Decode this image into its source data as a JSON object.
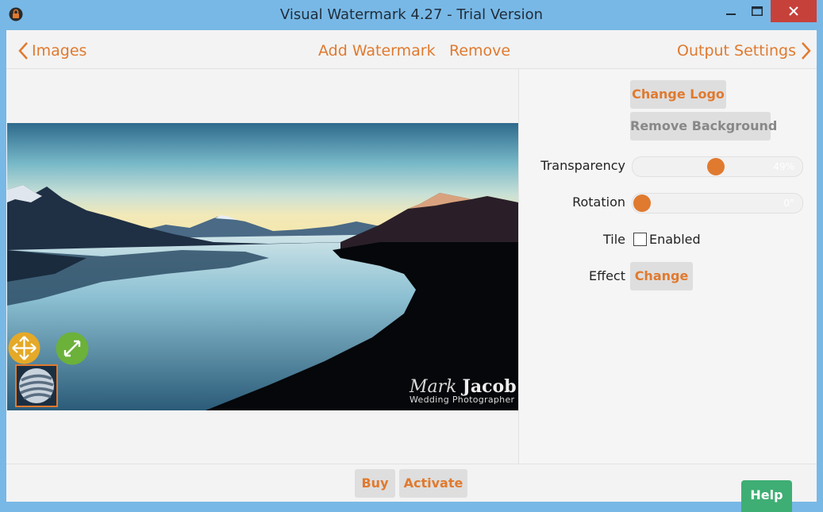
{
  "window": {
    "title": "Visual Watermark 4.27 - Trial Version",
    "icons": [
      "app-lock-icon",
      "minimize-icon",
      "maximize-icon",
      "close-icon"
    ],
    "close_color": "#c7413b"
  },
  "nav": {
    "back_label": "Images",
    "add_label": "Add Watermark",
    "remove_label": "Remove",
    "output_label": "Output Settings",
    "accent": "#e07a2f"
  },
  "watermark": {
    "first_name": "Mark",
    "last_name": "Jacob",
    "subtitle": "Wedding Photographer"
  },
  "panel": {
    "change_logo": "Change Logo",
    "remove_background": "Remove Background",
    "transparency_label": "Transparency",
    "transparency_value": "49%",
    "transparency_level": 0.49,
    "rotation_label": "Rotation",
    "rotation_value": "0°",
    "rotation_level": 0,
    "tile_label": "Tile",
    "tile_enabled_label": "Enabled",
    "tile_checked": false,
    "effect_label": "Effect",
    "effect_button": "Change"
  },
  "footer": {
    "buy": "Buy",
    "activate": "Activate",
    "help": "Help",
    "help_color": "#3fae74"
  }
}
